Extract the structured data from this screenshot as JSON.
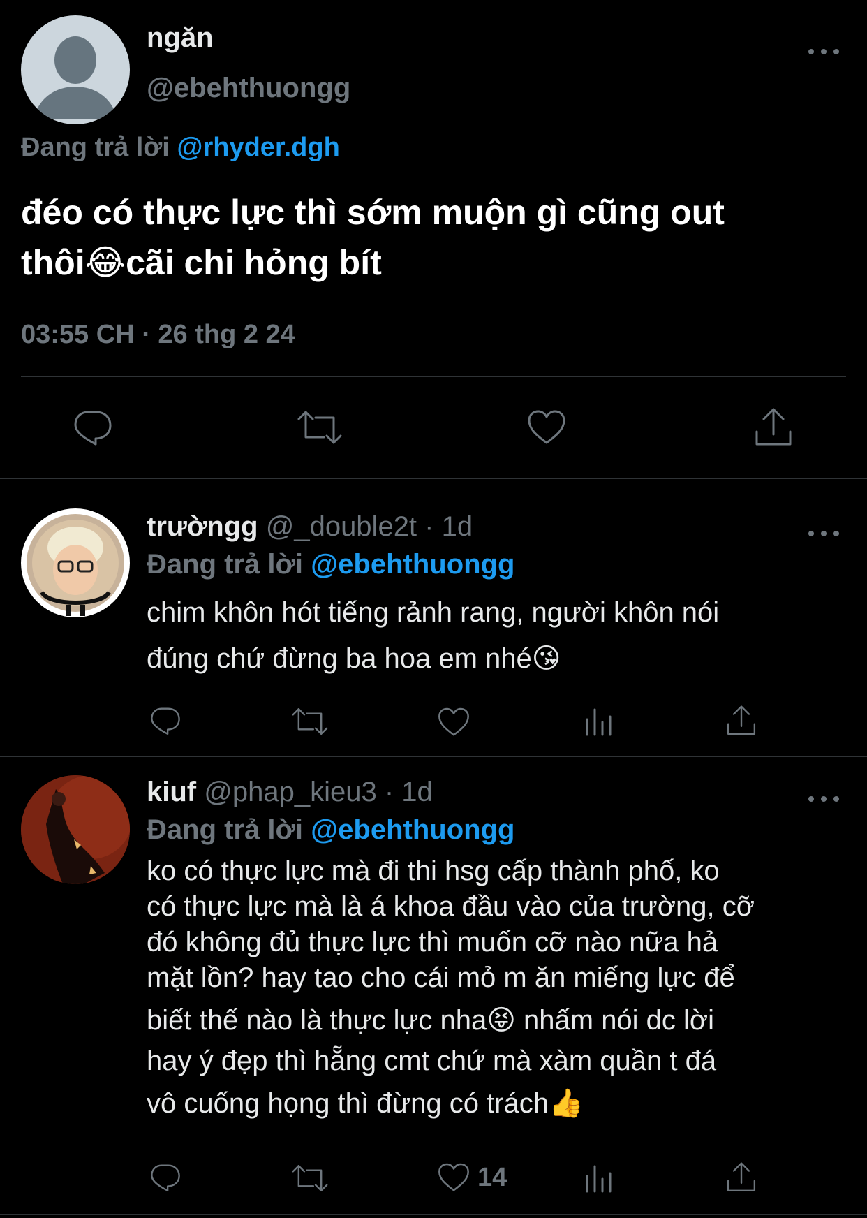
{
  "main_tweet": {
    "name": "ngăn",
    "handle": "@ebehthuongg",
    "replying_prefix": "Đang trả lời",
    "replying_to": "@rhyder.dgh",
    "text_line1": "đéo có thực lực thì sớm muộn gì cũng out",
    "text_line2_a": "thôi",
    "text_line2_emoji": "😂",
    "text_line2_b": "cãi chi hỏng bít",
    "timestamp": "03:55 CH · 26 thg 2 24"
  },
  "replies": [
    {
      "name": "trườngg",
      "handle": "@_double2t",
      "time": "· 1d",
      "replying_prefix": "Đang trả lời",
      "replying_to": "@ebehthuongg",
      "lines": [
        "chim khôn hót tiếng rảnh rang, người khôn nói",
        "đúng chứ đừng ba hoa em nhé"
      ],
      "emoji": "😘"
    },
    {
      "name": "kiuf",
      "handle": "@phap_kieu3",
      "time": "· 1d",
      "replying_prefix": "Đang trả lời",
      "replying_to": "@ebehthuongg",
      "lines": [
        "ko có thực lực mà đi thi hsg cấp thành phố, ko",
        "có thực lực mà là á khoa đầu vào của trường, cỡ",
        "đó không đủ thực lực thì muốn cỡ nào nữa hả",
        "mặt lồn? hay tao cho cái mỏ m ăn miếng lực để",
        "biết thế nào là thực lực nha",
        "nhấm nói dc lời",
        "hay ý đẹp thì hẵng cmt chứ mà xàm quần t đá",
        "vô cuống họng thì đừng có trách"
      ],
      "emoji_tongue": "😝",
      "emoji_thumb": "👍",
      "like_count": "14"
    }
  ],
  "icons": {
    "reply": "reply-icon",
    "retweet": "retweet-icon",
    "like": "like-icon",
    "views": "views-icon",
    "share": "share-icon",
    "more": "more-icon"
  },
  "colors": {
    "background": "#000000",
    "link": "#1d9bf0",
    "muted": "#6e767d",
    "text": "#e7e9ea"
  }
}
